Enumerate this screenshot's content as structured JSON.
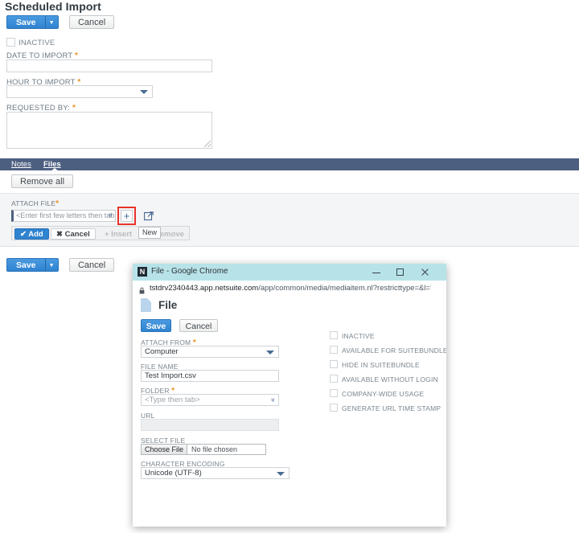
{
  "record": {
    "title": "Scheduled Import",
    "save_label": "Save",
    "cancel_label": "Cancel",
    "caret_glyph": "▼",
    "inactive_label": "INACTIVE",
    "fields": {
      "date_to_import": {
        "label": "DATE TO IMPORT",
        "required": "*",
        "value": ""
      },
      "hour_to_import": {
        "label": "HOUR TO IMPORT",
        "required": "*",
        "value": ""
      },
      "requested_by": {
        "label": "REQUESTED BY:",
        "required": "*",
        "value": ""
      }
    },
    "tabs": [
      {
        "label": "Notes",
        "active": false
      },
      {
        "label": "Files",
        "active": true
      }
    ],
    "remove_all_label": "Remove all",
    "sublist": {
      "attach_file_label": "ATTACH FILE",
      "attach_file_required": "*",
      "lookup_placeholder": "<Enter first few letters then tab>",
      "dbl_caret_glyph": "»",
      "plus_glyph": "+",
      "tooltip": "New",
      "buttons": {
        "add": "✔ Add",
        "cancel": "✖ Cancel",
        "insert": "+ Insert",
        "remove": "Remove"
      }
    },
    "highlight_color": "#e8332a",
    "accent_color": "#2f83d0",
    "tabbar_color": "#4d5f80"
  },
  "popup": {
    "window_title": "File - Google Chrome",
    "favicon_letter": "N",
    "url_host": "tstdrv2340443.app.netsuite.com",
    "url_path": "/app/common/media/mediaitem.nl?restricttype=&l=T&uploa...",
    "controls": {
      "minimize": "minimize",
      "maximize": "maximize",
      "close": "close"
    },
    "heading": "File",
    "save_label": "Save",
    "cancel_label": "Cancel",
    "fields": {
      "attach_from": {
        "label": "ATTACH FROM",
        "required": "*",
        "value": "Computer"
      },
      "file_name": {
        "label": "FILE NAME",
        "required": "",
        "value": "Test Import.csv"
      },
      "folder": {
        "label": "FOLDER",
        "required": "*",
        "value": "<Type then tab>"
      },
      "url": {
        "label": "URL",
        "required": "",
        "value": ""
      },
      "select_file": {
        "label": "SELECT FILE",
        "button": "Choose File",
        "status": "No file chosen"
      },
      "character_encoding": {
        "label": "CHARACTER ENCODING",
        "required": "",
        "value": "Unicode (UTF-8)"
      }
    },
    "checkboxes": [
      {
        "label": "INACTIVE",
        "checked": false
      },
      {
        "label": "AVAILABLE FOR SUITEBUNDLES",
        "checked": false
      },
      {
        "label": "HIDE IN SUITEBUNDLE",
        "checked": false
      },
      {
        "label": "AVAILABLE WITHOUT LOGIN",
        "checked": false
      },
      {
        "label": "COMPANY-WIDE USAGE",
        "checked": false
      },
      {
        "label": "GENERATE URL TIME STAMP",
        "checked": false
      }
    ]
  }
}
